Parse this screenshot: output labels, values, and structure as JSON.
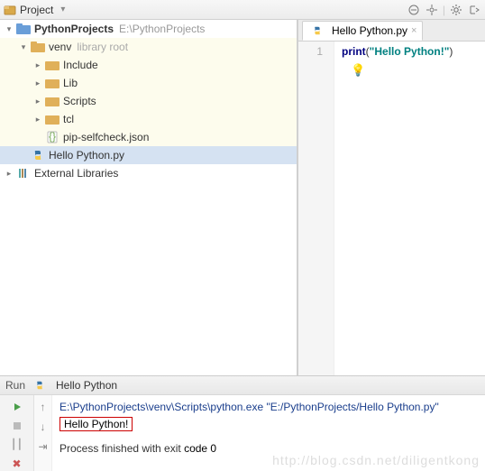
{
  "topbar": {
    "title": "Project"
  },
  "tree": {
    "project": {
      "name": "PythonProjects",
      "path": "E:\\PythonProjects"
    },
    "venv": {
      "name": "venv",
      "hint": "library root"
    },
    "folders": [
      "Include",
      "Lib",
      "Scripts",
      "tcl"
    ],
    "selfcheck": "pip-selfcheck.json",
    "hello_py": "Hello Python.py",
    "ext_lib": "External Libraries"
  },
  "editor": {
    "tab": "Hello Python.py",
    "line_no": "1",
    "code_fn": "print",
    "code_str": "\"Hello Python!\""
  },
  "run": {
    "title": "Hello Python",
    "cmd": "E:\\PythonProjects\\venv\\Scripts\\python.exe \"E:/PythonProjects/Hello Python.py\"",
    "output": "Hello Python!",
    "exit_prefix": "Process finished with exit ",
    "exit_code_label": "code 0"
  },
  "watermark": "http://blog.csdn.net/diligentkong"
}
